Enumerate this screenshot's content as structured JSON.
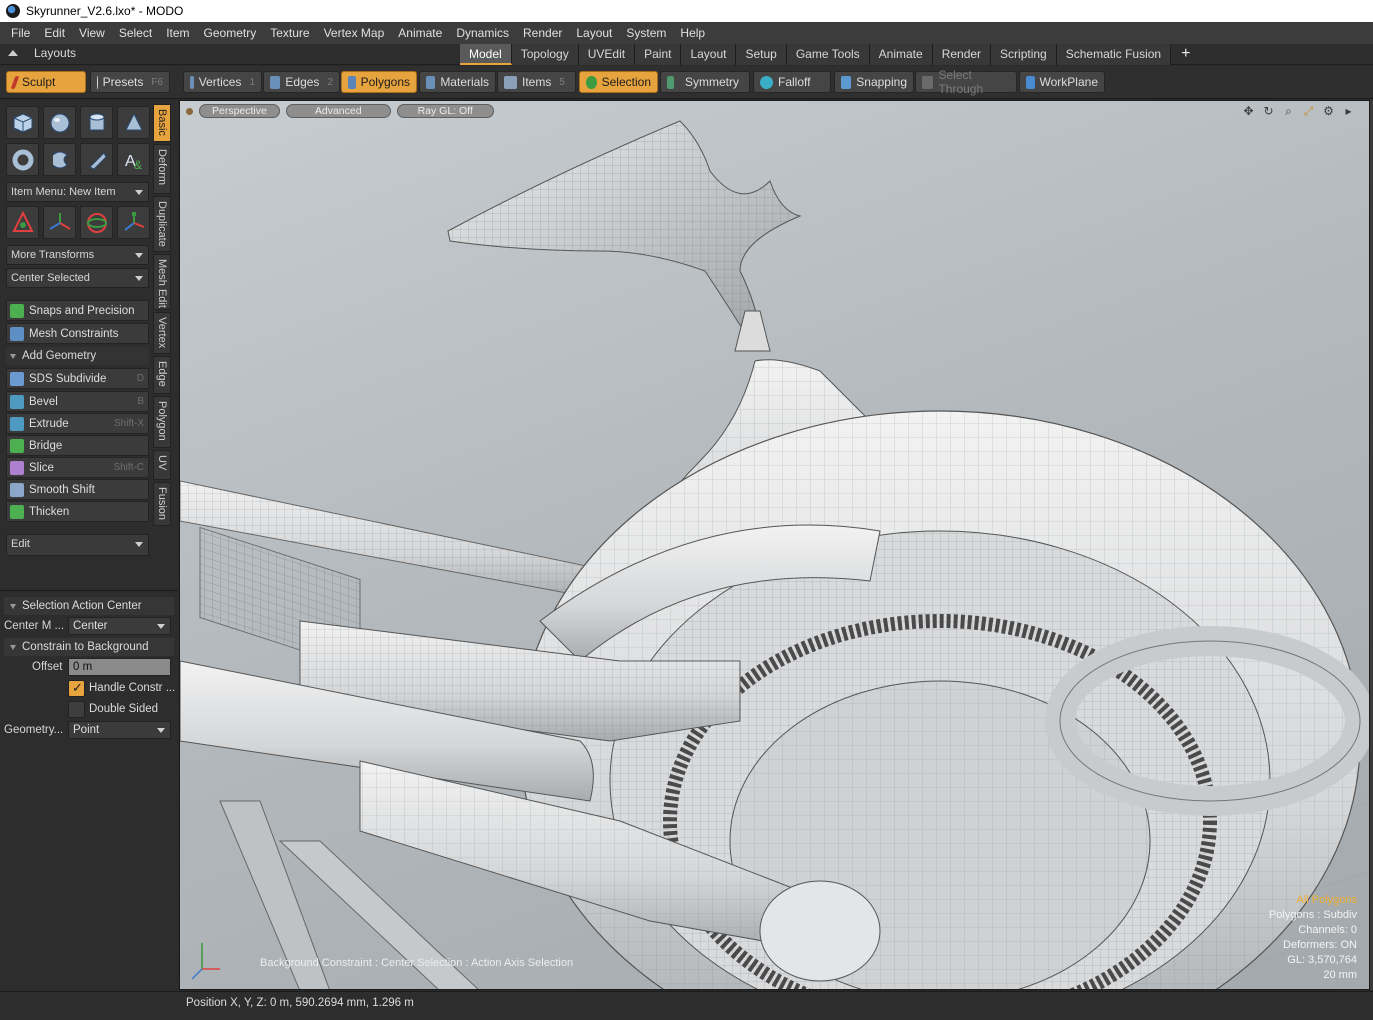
{
  "window": {
    "title": "Skyrunner_V2.6.lxo* - MODO"
  },
  "menu": [
    "File",
    "Edit",
    "View",
    "Select",
    "Item",
    "Geometry",
    "Texture",
    "Vertex Map",
    "Animate",
    "Dynamics",
    "Render",
    "Layout",
    "System",
    "Help"
  ],
  "layout_bar": {
    "label": "Layouts",
    "tabs": [
      "Model",
      "Topology",
      "UVEdit",
      "Paint",
      "Layout",
      "Setup",
      "Game Tools",
      "Animate",
      "Render",
      "Scripting",
      "Schematic Fusion"
    ],
    "active_tab": "Model",
    "add_label": "+"
  },
  "toolrow": {
    "sculpt": "Sculpt",
    "presets": "Presets",
    "presets_key": "F6",
    "vertices": "Vertices",
    "vertices_key": "1",
    "edges": "Edges",
    "edges_key": "2",
    "polygons": "Polygons",
    "materials": "Materials",
    "items": "Items",
    "items_key": "5",
    "selection": "Selection",
    "symmetry": "Symmetry",
    "falloff": "Falloff",
    "snapping": "Snapping",
    "select_through": "Select Through",
    "workplane": "WorkPlane"
  },
  "toolbox": {
    "item_menu": "Item Menu: New Item",
    "more_transforms": "More Transforms",
    "center_selected": "Center Selected",
    "snaps": "Snaps and Precision",
    "mesh_constraints": "Mesh Constraints",
    "add_geometry": "Add Geometry",
    "tools": [
      {
        "label": "SDS Subdivide",
        "key": "D"
      },
      {
        "label": "Bevel",
        "key": "B"
      },
      {
        "label": "Extrude",
        "key": "Shift-X"
      },
      {
        "label": "Bridge",
        "key": ""
      },
      {
        "label": "Slice",
        "key": "Shift-C"
      },
      {
        "label": "Smooth Shift",
        "key": ""
      },
      {
        "label": "Thicken",
        "key": ""
      }
    ],
    "edit": "Edit"
  },
  "vertical_tabs": [
    "Basic",
    "Deform",
    "Duplicate",
    "Mesh Edit",
    "Vertex",
    "Edge",
    "Polygon",
    "UV",
    "Fusion"
  ],
  "properties": {
    "section1": "Selection Action Center",
    "center_mode_label": "Center M ...",
    "center_mode_value": "Center",
    "section2": "Constrain to Background",
    "offset_label": "Offset",
    "offset_value": "0 m",
    "handle_constraint": "Handle Constr ...",
    "handle_constraint_checked": true,
    "double_sided": "Double Sided",
    "double_sided_checked": false,
    "geometry_label": "Geometry...",
    "geometry_value": "Point"
  },
  "viewport": {
    "view_mode": "Perspective",
    "advanced": "Advanced",
    "raygl": "Ray GL: Off",
    "status_text": "Background Constraint : Center Selection : Action Axis Selection",
    "info": {
      "all_polygons": "All Polygons",
      "polygons": "Polygons : Subdiv",
      "channels": "Channels: 0",
      "deformers": "Deformers: ON",
      "gl": "GL: 3,570,764",
      "scale": "20 mm"
    }
  },
  "statusbar": {
    "position": "Position X, Y, Z:   0 m, 590.2694 mm, 1.296 m"
  },
  "colors": {
    "accent": "#e7a33e",
    "panel": "#2d2d2d",
    "viewport_bg": "#b8bec2"
  }
}
